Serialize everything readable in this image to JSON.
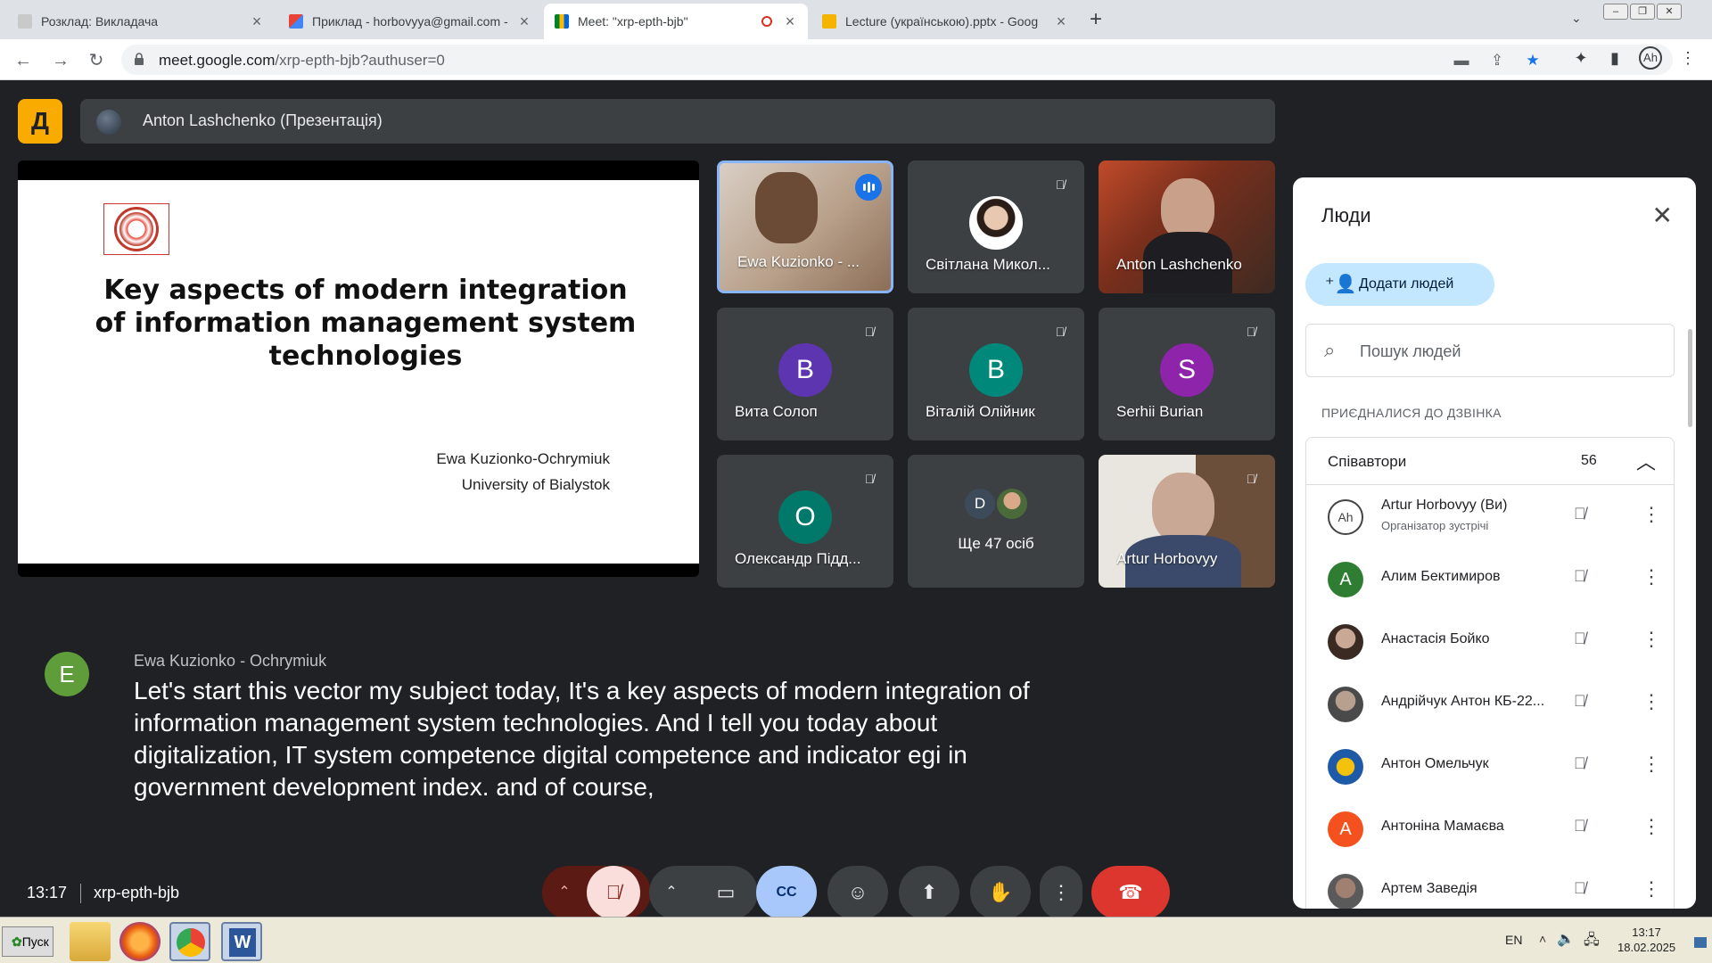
{
  "browser": {
    "tabs": [
      {
        "title": "Розклад: Викладача",
        "active": false
      },
      {
        "title": "Приклад - horbovyya@gmail.com - G",
        "active": false
      },
      {
        "title": "Meet: \"xrp-epth-bjb\"",
        "active": true
      },
      {
        "title": "Lecture (українською).pptx - Goog",
        "active": false
      }
    ],
    "new_tab": "+",
    "url_host": "meet.google.com",
    "url_path": "/xrp-epth-bjb?authuser=0"
  },
  "meet": {
    "presenter_label": "Anton Lashchenko (Презентація)",
    "slide": {
      "title": "Key aspects of modern integration of information management system technologies",
      "author": "Ewa Kuzionko-Ochrymiuk",
      "affiliation": "University of Bialystok"
    },
    "tiles": [
      {
        "name": "Ewa Kuzionko - ...",
        "type": "video",
        "speaking": true
      },
      {
        "name": "Світлана Микол...",
        "type": "photo",
        "muted": true
      },
      {
        "name": "Anton Lashchenko",
        "type": "video"
      },
      {
        "name": "Вита Солоп",
        "letter": "В",
        "color": "#5e35b1",
        "muted": true
      },
      {
        "name": "Віталій Олійник",
        "letter": "В",
        "color": "#00897b",
        "muted": true
      },
      {
        "name": "Serhii Burian",
        "letter": "S",
        "color": "#8e24aa",
        "muted": true
      },
      {
        "name": "Олександр Підд...",
        "letter": "О",
        "color": "#00796b",
        "muted": true
      },
      {
        "name": "Ще 47 осіб",
        "type": "more",
        "letter": "D"
      },
      {
        "name": "Artur Horbovyy",
        "type": "video",
        "muted": true
      }
    ],
    "caption": {
      "avatar_letter": "E",
      "speaker": "Ewa Kuzionko - Ochrymiuk",
      "text": "Let's start this vector my subject today, It's a key aspects of modern integration of information management system technologies. And I tell you today about digitalization, IT system competence digital competence and indicator egi in government development index. and of course,"
    },
    "time": "13:17",
    "meeting_code": "xrp-epth-bjb",
    "people_count_badge": "56"
  },
  "people_panel": {
    "title": "Люди",
    "add_people": "Додати людей",
    "search_placeholder": "Пошук людей",
    "section_label": "ПРИЄДНАЛИСЯ ДО ДЗВІНКА",
    "group_label": "Співавтори",
    "group_count": "56",
    "people": [
      {
        "name": "Artur Horbovyy (Ви)",
        "role": "Організатор зустрічі",
        "avatar": "logo"
      },
      {
        "name": "Алим Бектимиров",
        "letter": "А",
        "color": "#2e7d32"
      },
      {
        "name": "Анастасія Бойко",
        "avatar": "photo"
      },
      {
        "name": "Андрійчук Антон КБ-22...",
        "avatar": "photo"
      },
      {
        "name": "Антон Омельчук",
        "avatar": "emblem"
      },
      {
        "name": "Антоніна Мамаєва",
        "letter": "А",
        "color": "#f4511e"
      },
      {
        "name": "Артем Заведія",
        "avatar": "photo"
      }
    ]
  },
  "taskbar": {
    "start": "Пуск",
    "lang": "EN",
    "clock_time": "13:17",
    "clock_date": "18.02.2025"
  }
}
